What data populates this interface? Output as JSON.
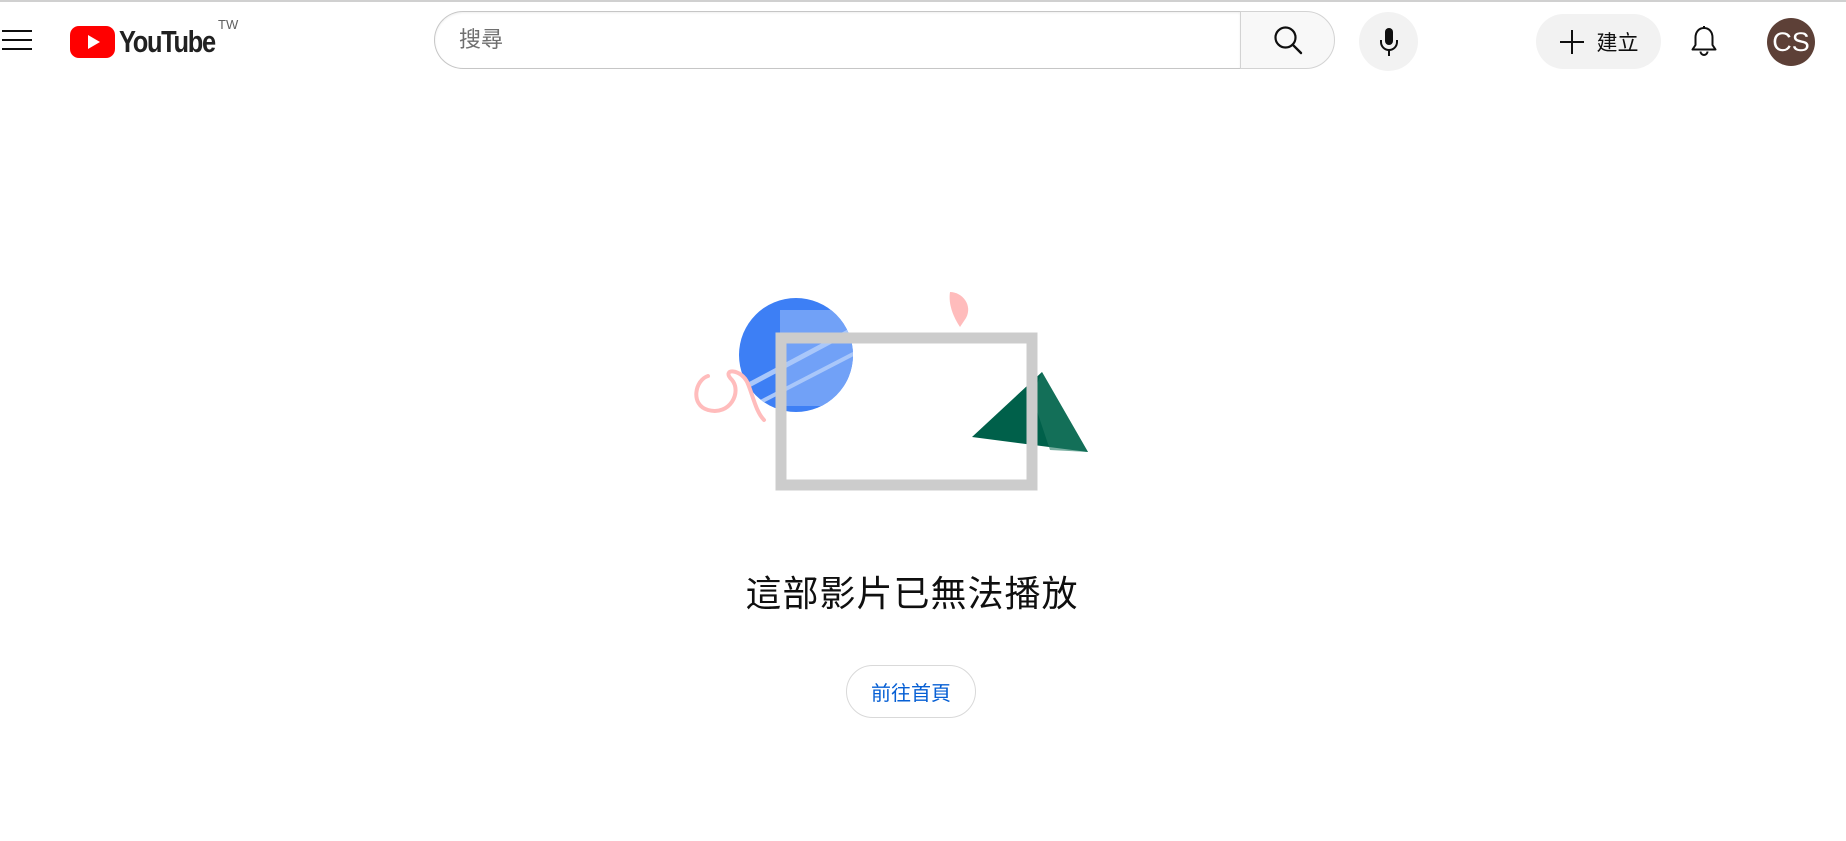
{
  "header": {
    "logo_text": "YouTube",
    "country_code": "TW",
    "search": {
      "placeholder": "搜尋",
      "value": ""
    },
    "create_label": "建立",
    "avatar_initials": "CS"
  },
  "main": {
    "message": "這部影片已無法播放",
    "home_button_label": "前往首頁"
  },
  "colors": {
    "brand_red": "#ff0000",
    "link_blue": "#065fd4",
    "avatar_bg": "#5d4037",
    "illustration_blue": "#3d7ff5",
    "illustration_green": "#00604a",
    "illustration_pink": "#ffbcbc",
    "illustration_frame": "#cccccc"
  },
  "icons": {
    "menu": "hamburger-menu-icon",
    "search": "magnifier-icon",
    "mic": "microphone-icon",
    "create": "plus-icon",
    "notifications": "bell-icon"
  }
}
